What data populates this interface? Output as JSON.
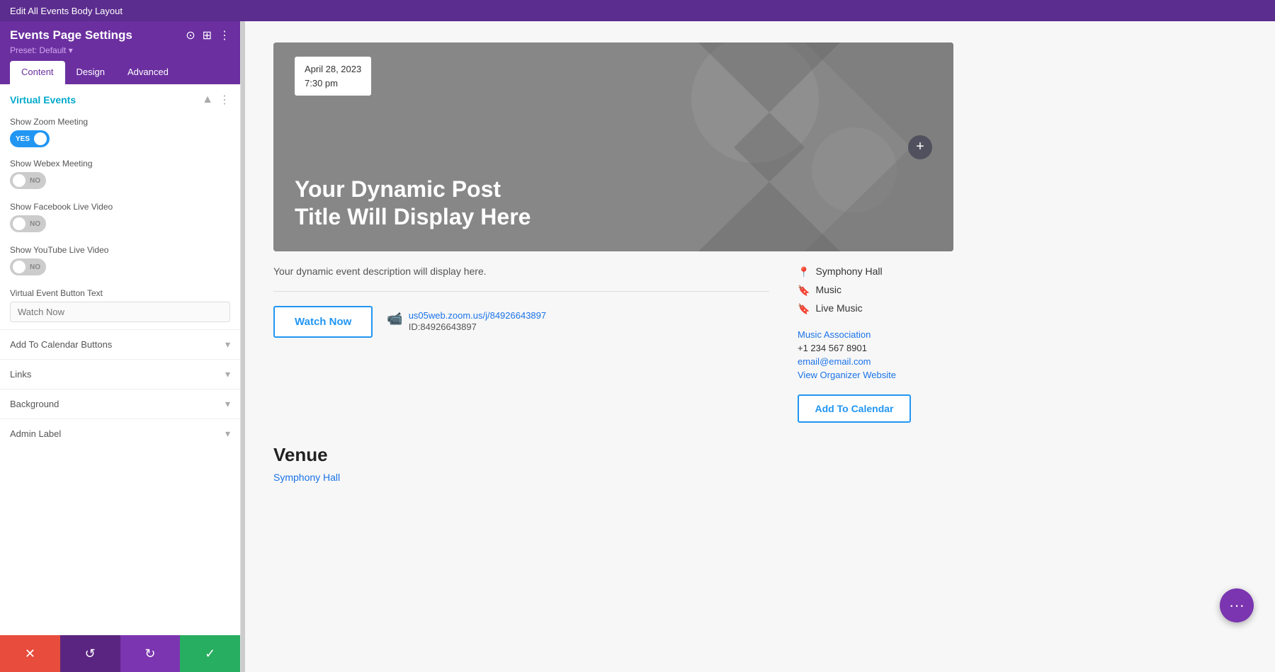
{
  "topbar": {
    "title": "Edit All Events Body Layout"
  },
  "sidebar": {
    "title": "Events Page Settings",
    "preset": "Preset: Default ▾",
    "tabs": [
      {
        "label": "Content",
        "active": true
      },
      {
        "label": "Design",
        "active": false
      },
      {
        "label": "Advanced",
        "active": false
      }
    ],
    "virtual_events": {
      "section_title": "Virtual Events",
      "show_zoom": {
        "label": "Show Zoom Meeting",
        "value": "YES",
        "state": "on"
      },
      "show_webex": {
        "label": "Show Webex Meeting",
        "value": "NO",
        "state": "off"
      },
      "show_facebook": {
        "label": "Show Facebook Live Video",
        "value": "NO",
        "state": "off"
      },
      "show_youtube": {
        "label": "Show YouTube Live Video",
        "value": "NO",
        "state": "off"
      },
      "button_text": {
        "label": "Virtual Event Button Text",
        "placeholder": "Watch Now"
      }
    },
    "sections": [
      {
        "label": "Add To Calendar Buttons"
      },
      {
        "label": "Links"
      },
      {
        "label": "Background"
      },
      {
        "label": "Admin Label"
      }
    ]
  },
  "toolbar": {
    "cancel_icon": "✕",
    "undo_icon": "↺",
    "redo_icon": "↻",
    "save_icon": "✓"
  },
  "hero": {
    "date": "April 28, 2023",
    "time": "7:30 pm",
    "title": "Your Dynamic Post Title Will Display Here"
  },
  "event": {
    "description": "Your dynamic event description will display here.",
    "watch_button": "Watch Now",
    "zoom_link": "us05web.zoom.us/j/84926643897",
    "zoom_id": "ID:84926643897"
  },
  "sidebar_info": {
    "venue": "Symphony Hall",
    "tags": [
      "Music",
      "Live Music"
    ],
    "organizer": "Music Association",
    "phone": "+1 234 567 8901",
    "email": "email@email.com",
    "website": "View Organizer Website",
    "add_calendar": "Add To Calendar"
  },
  "venue_section": {
    "title": "Venue",
    "link": "Symphony Hall"
  },
  "float_btn": "···"
}
